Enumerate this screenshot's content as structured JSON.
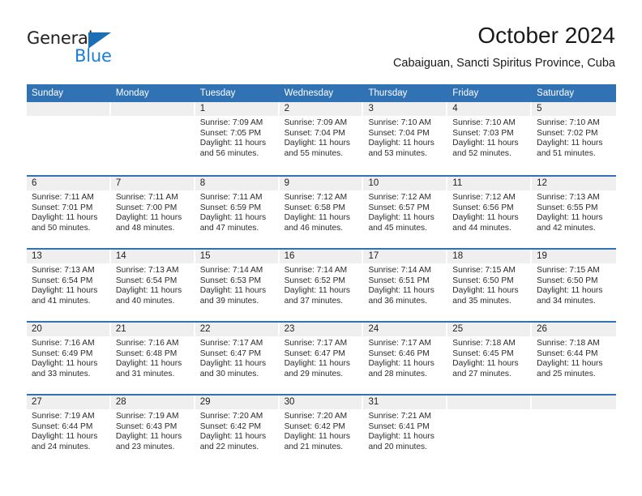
{
  "logo": {
    "word_top": "General",
    "word_bottom": "Blue",
    "triangle_color": "#1a6fb5",
    "blue_text_color": "#1a7fd4"
  },
  "header": {
    "title": "October 2024",
    "location": "Cabaiguan, Sancti Spiritus Province, Cuba"
  },
  "theme": {
    "header_blue": "#3072b4",
    "day_band_gray": "#efefef",
    "text_color": "#2b2b2b"
  },
  "weekdays": [
    "Sunday",
    "Monday",
    "Tuesday",
    "Wednesday",
    "Thursday",
    "Friday",
    "Saturday"
  ],
  "weeks": [
    [
      {
        "day": "",
        "sunrise": "",
        "sunset": "",
        "daylight": ""
      },
      {
        "day": "",
        "sunrise": "",
        "sunset": "",
        "daylight": ""
      },
      {
        "day": "1",
        "sunrise": "Sunrise: 7:09 AM",
        "sunset": "Sunset: 7:05 PM",
        "daylight": "Daylight: 11 hours and 56 minutes."
      },
      {
        "day": "2",
        "sunrise": "Sunrise: 7:09 AM",
        "sunset": "Sunset: 7:04 PM",
        "daylight": "Daylight: 11 hours and 55 minutes."
      },
      {
        "day": "3",
        "sunrise": "Sunrise: 7:10 AM",
        "sunset": "Sunset: 7:04 PM",
        "daylight": "Daylight: 11 hours and 53 minutes."
      },
      {
        "day": "4",
        "sunrise": "Sunrise: 7:10 AM",
        "sunset": "Sunset: 7:03 PM",
        "daylight": "Daylight: 11 hours and 52 minutes."
      },
      {
        "day": "5",
        "sunrise": "Sunrise: 7:10 AM",
        "sunset": "Sunset: 7:02 PM",
        "daylight": "Daylight: 11 hours and 51 minutes."
      }
    ],
    [
      {
        "day": "6",
        "sunrise": "Sunrise: 7:11 AM",
        "sunset": "Sunset: 7:01 PM",
        "daylight": "Daylight: 11 hours and 50 minutes."
      },
      {
        "day": "7",
        "sunrise": "Sunrise: 7:11 AM",
        "sunset": "Sunset: 7:00 PM",
        "daylight": "Daylight: 11 hours and 48 minutes."
      },
      {
        "day": "8",
        "sunrise": "Sunrise: 7:11 AM",
        "sunset": "Sunset: 6:59 PM",
        "daylight": "Daylight: 11 hours and 47 minutes."
      },
      {
        "day": "9",
        "sunrise": "Sunrise: 7:12 AM",
        "sunset": "Sunset: 6:58 PM",
        "daylight": "Daylight: 11 hours and 46 minutes."
      },
      {
        "day": "10",
        "sunrise": "Sunrise: 7:12 AM",
        "sunset": "Sunset: 6:57 PM",
        "daylight": "Daylight: 11 hours and 45 minutes."
      },
      {
        "day": "11",
        "sunrise": "Sunrise: 7:12 AM",
        "sunset": "Sunset: 6:56 PM",
        "daylight": "Daylight: 11 hours and 44 minutes."
      },
      {
        "day": "12",
        "sunrise": "Sunrise: 7:13 AM",
        "sunset": "Sunset: 6:55 PM",
        "daylight": "Daylight: 11 hours and 42 minutes."
      }
    ],
    [
      {
        "day": "13",
        "sunrise": "Sunrise: 7:13 AM",
        "sunset": "Sunset: 6:54 PM",
        "daylight": "Daylight: 11 hours and 41 minutes."
      },
      {
        "day": "14",
        "sunrise": "Sunrise: 7:13 AM",
        "sunset": "Sunset: 6:54 PM",
        "daylight": "Daylight: 11 hours and 40 minutes."
      },
      {
        "day": "15",
        "sunrise": "Sunrise: 7:14 AM",
        "sunset": "Sunset: 6:53 PM",
        "daylight": "Daylight: 11 hours and 39 minutes."
      },
      {
        "day": "16",
        "sunrise": "Sunrise: 7:14 AM",
        "sunset": "Sunset: 6:52 PM",
        "daylight": "Daylight: 11 hours and 37 minutes."
      },
      {
        "day": "17",
        "sunrise": "Sunrise: 7:14 AM",
        "sunset": "Sunset: 6:51 PM",
        "daylight": "Daylight: 11 hours and 36 minutes."
      },
      {
        "day": "18",
        "sunrise": "Sunrise: 7:15 AM",
        "sunset": "Sunset: 6:50 PM",
        "daylight": "Daylight: 11 hours and 35 minutes."
      },
      {
        "day": "19",
        "sunrise": "Sunrise: 7:15 AM",
        "sunset": "Sunset: 6:50 PM",
        "daylight": "Daylight: 11 hours and 34 minutes."
      }
    ],
    [
      {
        "day": "20",
        "sunrise": "Sunrise: 7:16 AM",
        "sunset": "Sunset: 6:49 PM",
        "daylight": "Daylight: 11 hours and 33 minutes."
      },
      {
        "day": "21",
        "sunrise": "Sunrise: 7:16 AM",
        "sunset": "Sunset: 6:48 PM",
        "daylight": "Daylight: 11 hours and 31 minutes."
      },
      {
        "day": "22",
        "sunrise": "Sunrise: 7:17 AM",
        "sunset": "Sunset: 6:47 PM",
        "daylight": "Daylight: 11 hours and 30 minutes."
      },
      {
        "day": "23",
        "sunrise": "Sunrise: 7:17 AM",
        "sunset": "Sunset: 6:47 PM",
        "daylight": "Daylight: 11 hours and 29 minutes."
      },
      {
        "day": "24",
        "sunrise": "Sunrise: 7:17 AM",
        "sunset": "Sunset: 6:46 PM",
        "daylight": "Daylight: 11 hours and 28 minutes."
      },
      {
        "day": "25",
        "sunrise": "Sunrise: 7:18 AM",
        "sunset": "Sunset: 6:45 PM",
        "daylight": "Daylight: 11 hours and 27 minutes."
      },
      {
        "day": "26",
        "sunrise": "Sunrise: 7:18 AM",
        "sunset": "Sunset: 6:44 PM",
        "daylight": "Daylight: 11 hours and 25 minutes."
      }
    ],
    [
      {
        "day": "27",
        "sunrise": "Sunrise: 7:19 AM",
        "sunset": "Sunset: 6:44 PM",
        "daylight": "Daylight: 11 hours and 24 minutes."
      },
      {
        "day": "28",
        "sunrise": "Sunrise: 7:19 AM",
        "sunset": "Sunset: 6:43 PM",
        "daylight": "Daylight: 11 hours and 23 minutes."
      },
      {
        "day": "29",
        "sunrise": "Sunrise: 7:20 AM",
        "sunset": "Sunset: 6:42 PM",
        "daylight": "Daylight: 11 hours and 22 minutes."
      },
      {
        "day": "30",
        "sunrise": "Sunrise: 7:20 AM",
        "sunset": "Sunset: 6:42 PM",
        "daylight": "Daylight: 11 hours and 21 minutes."
      },
      {
        "day": "31",
        "sunrise": "Sunrise: 7:21 AM",
        "sunset": "Sunset: 6:41 PM",
        "daylight": "Daylight: 11 hours and 20 minutes."
      },
      {
        "day": "",
        "sunrise": "",
        "sunset": "",
        "daylight": ""
      },
      {
        "day": "",
        "sunrise": "",
        "sunset": "",
        "daylight": ""
      }
    ]
  ]
}
